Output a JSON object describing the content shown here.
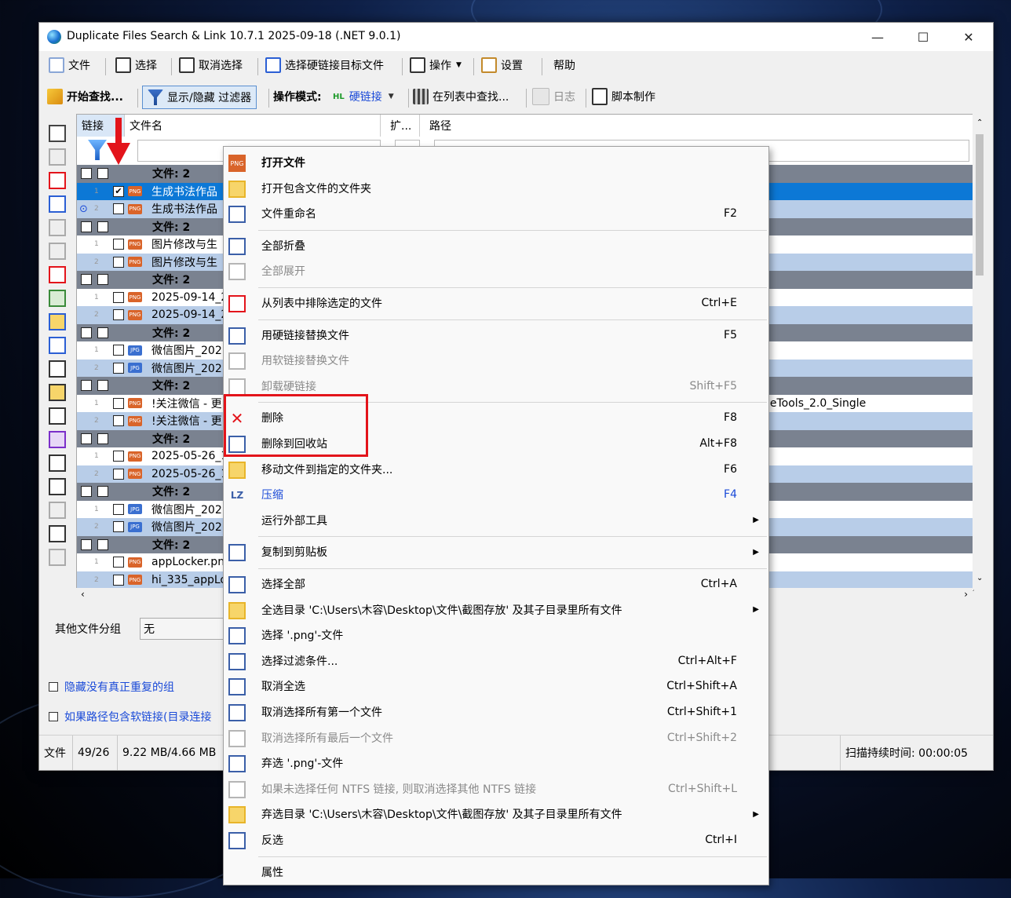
{
  "window": {
    "title": "Duplicate Files Search & Link 10.7.1 2025-09-18 (.NET 9.0.1)"
  },
  "menubar": [
    {
      "label": "文件",
      "icon": "file-icon"
    },
    {
      "label": "选择",
      "icon": "select-icon"
    },
    {
      "label": "取消选择",
      "icon": "deselect-icon"
    },
    {
      "label": "选择硬链接目标文件",
      "icon": "hardlink-target-icon"
    },
    {
      "label": "操作",
      "icon": "operation-icon"
    },
    {
      "label": "设置",
      "icon": "settings-icon"
    },
    {
      "label": "帮助",
      "icon": ""
    }
  ],
  "toolbar": {
    "start_search": "开始查找...",
    "toggle_filter": "显示/隐藏 过滤器",
    "op_mode_label": "操作模式:",
    "op_mode_value": "硬链接",
    "find_in_list": "在列表中查找...",
    "log": "日志",
    "script": "脚本制作"
  },
  "columns": {
    "link": "链接",
    "filename": "文件名",
    "ext": "扩...",
    "path": "路径"
  },
  "rows": [
    {
      "type": "group",
      "text": "文件: 2"
    },
    {
      "type": "file",
      "idx": "1",
      "ft": "PNG",
      "name": "生成书法作品",
      "checked": true,
      "style": "sel"
    },
    {
      "type": "file",
      "idx": "2",
      "ft": "PNG",
      "name": "生成书法作品",
      "checked": false,
      "style": "f2"
    },
    {
      "type": "group",
      "text": "文件: 2"
    },
    {
      "type": "file",
      "idx": "1",
      "ft": "PNG",
      "name": "图片修改与生",
      "checked": false,
      "style": "f1"
    },
    {
      "type": "file",
      "idx": "2",
      "ft": "PNG",
      "name": "图片修改与生",
      "checked": false,
      "style": "f2"
    },
    {
      "type": "group",
      "text": "文件: 2"
    },
    {
      "type": "file",
      "idx": "1",
      "ft": "PNG",
      "name": "2025-09-14_22",
      "checked": false,
      "style": "f1"
    },
    {
      "type": "file",
      "idx": "2",
      "ft": "PNG",
      "name": "2025-09-14_22",
      "checked": false,
      "style": "f2"
    },
    {
      "type": "group",
      "text": "文件: 2"
    },
    {
      "type": "file",
      "idx": "1",
      "ft": "JPG",
      "name": "微信图片_202",
      "checked": false,
      "style": "f1"
    },
    {
      "type": "file",
      "idx": "2",
      "ft": "JPG",
      "name": "微信图片_202",
      "checked": false,
      "style": "f2"
    },
    {
      "type": "group",
      "text": "文件: 2"
    },
    {
      "type": "file",
      "idx": "1",
      "ft": "PNG",
      "name": "!关注微信 - 更",
      "checked": false,
      "style": "f1",
      "path": "geTools_2.0_Single"
    },
    {
      "type": "file",
      "idx": "2",
      "ft": "PNG",
      "name": "!关注微信 - 更",
      "checked": false,
      "style": "f2"
    },
    {
      "type": "group",
      "text": "文件: 2"
    },
    {
      "type": "file",
      "idx": "1",
      "ft": "PNG",
      "name": "2025-05-26_16",
      "checked": false,
      "style": "f1"
    },
    {
      "type": "file",
      "idx": "2",
      "ft": "PNG",
      "name": "2025-05-26_16",
      "checked": false,
      "style": "f2"
    },
    {
      "type": "group",
      "text": "文件: 2"
    },
    {
      "type": "file",
      "idx": "1",
      "ft": "JPG",
      "name": "微信图片_202",
      "checked": false,
      "style": "f1"
    },
    {
      "type": "file",
      "idx": "2",
      "ft": "JPG",
      "name": "微信图片_202",
      "checked": false,
      "style": "f2"
    },
    {
      "type": "group",
      "text": "文件: 2"
    },
    {
      "type": "file",
      "idx": "1",
      "ft": "PNG",
      "name": "appLocker.png",
      "checked": false,
      "style": "f1"
    },
    {
      "type": "file",
      "idx": "2",
      "ft": "PNG",
      "name": "hi_335_appLoc",
      "checked": false,
      "style": "f2"
    }
  ],
  "bottom": {
    "other_group_label": "其他文件分组",
    "other_group_value": "无",
    "hide_non_dup": "隐藏没有真正重复的组",
    "path_softlink": "如果路径包含软链接(目录连接"
  },
  "status": {
    "files_label": "文件",
    "count": "49/26",
    "size": "9.22 MB/4.66 MB",
    "scan_time": "扫描持续时间: 00:00:05"
  },
  "context_menu": [
    {
      "label": "打开文件",
      "bold": true,
      "icon": "png-file-icon"
    },
    {
      "label": "打开包含文件的文件夹",
      "icon": "folder-icon"
    },
    {
      "label": "文件重命名",
      "shortcut": "F2",
      "icon": "pencil-icon"
    },
    {
      "sep": true
    },
    {
      "label": "全部折叠",
      "icon": "collapse-icon"
    },
    {
      "label": "全部展开",
      "disabled": true,
      "icon": "expand-icon"
    },
    {
      "sep": true
    },
    {
      "label": "从列表中排除选定的文件",
      "shortcut": "Ctrl+E",
      "icon": "exclude-icon"
    },
    {
      "sep": true
    },
    {
      "label": "用硬链接替换文件",
      "shortcut": "F5",
      "icon": "hardlink-icon"
    },
    {
      "label": "用软链接替换文件",
      "disabled": true,
      "icon": "softlink-icon"
    },
    {
      "label": "卸载硬链接",
      "shortcut": "Shift+F5",
      "disabled": true,
      "icon": "unlink-icon"
    },
    {
      "sep": true
    },
    {
      "label": "删除",
      "shortcut": "F8",
      "icon": "delete-icon"
    },
    {
      "label": "删除到回收站",
      "shortcut": "Alt+F8",
      "icon": "recycle-bin-icon"
    },
    {
      "label": "移动文件到指定的文件夹...",
      "shortcut": "F6",
      "icon": "move-folder-icon"
    },
    {
      "label": "压缩",
      "shortcut": "F4",
      "blue": true,
      "icon": "compress-icon"
    },
    {
      "label": "运行外部工具",
      "submenu": true,
      "icon": ""
    },
    {
      "sep": true
    },
    {
      "label": "复制到剪贴板",
      "submenu": true,
      "icon": "clipboard-icon"
    },
    {
      "sep": true
    },
    {
      "label": "选择全部",
      "shortcut": "Ctrl+A",
      "icon": "select-all-icon"
    },
    {
      "label": "全选目录 'C:\\Users\\木容\\Desktop\\文件\\截图存放' 及其子目录里所有文件",
      "submenu": true,
      "icon": "folder-select-icon"
    },
    {
      "label": "选择 '.png'-文件",
      "icon": "ext-select-icon"
    },
    {
      "label": "选择过滤条件...",
      "shortcut": "Ctrl+Alt+F",
      "icon": "filter-select-icon"
    },
    {
      "label": "取消全选",
      "shortcut": "Ctrl+Shift+A",
      "icon": "deselect-all-icon"
    },
    {
      "label": "取消选择所有第一个文件",
      "shortcut": "Ctrl+Shift+1",
      "icon": "deselect-first-icon"
    },
    {
      "label": "取消选择所有最后一个文件",
      "shortcut": "Ctrl+Shift+2",
      "disabled": true,
      "icon": "deselect-last-icon"
    },
    {
      "label": "弃选 '.png'-文件",
      "icon": "ext-deselect-icon"
    },
    {
      "label": "如果未选择任何 NTFS 链接, 则取消选择其他 NTFS 链接",
      "shortcut": "Ctrl+Shift+L",
      "disabled": true,
      "icon": "ntfs-icon"
    },
    {
      "label": "弃选目录 'C:\\Users\\木容\\Desktop\\文件\\截图存放' 及其子目录里所有文件",
      "submenu": true,
      "icon": "folder-deselect-icon"
    },
    {
      "label": "反选",
      "shortcut": "Ctrl+I",
      "icon": "invert-icon"
    },
    {
      "sep": true
    },
    {
      "label": "属性",
      "icon": ""
    }
  ],
  "colors": {
    "highlight": "#e3141b",
    "selection": "#0c78d6",
    "group_row": "#7a8290",
    "alt_row": "#b8cde8"
  }
}
